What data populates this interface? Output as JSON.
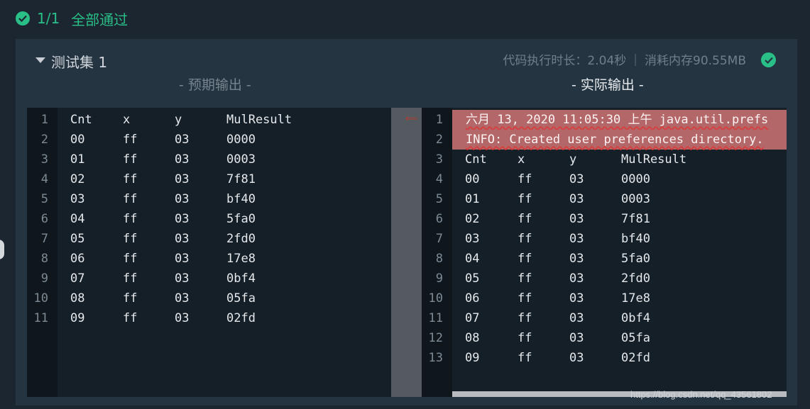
{
  "summary": {
    "count": "1/1",
    "status": "全部通过"
  },
  "suite": {
    "title": "测试集 1",
    "exec_time": "代码执行时长：2.04秒",
    "separator": "|",
    "memory": "消耗内存90.55MB",
    "expected_label": "- 预期输出 -",
    "actual_label": "- 实际输出 -"
  },
  "expected": {
    "line_numbers": [
      "1",
      "2",
      "3",
      "4",
      "5",
      "6",
      "7",
      "8",
      "9",
      "10",
      "11"
    ],
    "rows": [
      [
        "Cnt",
        "x",
        "y",
        "MulResult"
      ],
      [
        "00",
        "ff",
        "03",
        "0000"
      ],
      [
        "01",
        "ff",
        "03",
        "0003"
      ],
      [
        "02",
        "ff",
        "03",
        "7f81"
      ],
      [
        "03",
        "ff",
        "03",
        "bf40"
      ],
      [
        "04",
        "ff",
        "03",
        "5fa0"
      ],
      [
        "05",
        "ff",
        "03",
        "2fd0"
      ],
      [
        "06",
        "ff",
        "03",
        "17e8"
      ],
      [
        "07",
        "ff",
        "03",
        "0bf4"
      ],
      [
        "08",
        "ff",
        "03",
        "05fa"
      ],
      [
        "09",
        "ff",
        "03",
        "02fd"
      ]
    ]
  },
  "actual": {
    "line_numbers": [
      "1",
      "2",
      "3",
      "4",
      "5",
      "6",
      "7",
      "8",
      "9",
      "10",
      "11",
      "12",
      "13"
    ],
    "extra_lines": [
      "六月 13, 2020 11:05:30 上午 java.util.prefs",
      "INFO: Created user preferences directory."
    ],
    "rows": [
      [
        "Cnt",
        "x",
        "y",
        "MulResult"
      ],
      [
        "00",
        "ff",
        "03",
        "0000"
      ],
      [
        "01",
        "ff",
        "03",
        "0003"
      ],
      [
        "02",
        "ff",
        "03",
        "7f81"
      ],
      [
        "03",
        "ff",
        "03",
        "bf40"
      ],
      [
        "04",
        "ff",
        "03",
        "5fa0"
      ],
      [
        "05",
        "ff",
        "03",
        "2fd0"
      ],
      [
        "06",
        "ff",
        "03",
        "17e8"
      ],
      [
        "07",
        "ff",
        "03",
        "0bf4"
      ],
      [
        "08",
        "ff",
        "03",
        "05fa"
      ],
      [
        "09",
        "ff",
        "03",
        "02fd"
      ]
    ]
  },
  "watermark": "https://blog.csdn.net/qq_43561802",
  "colors": {
    "accent": "#29bf87",
    "diff_highlight": "#b46768"
  }
}
